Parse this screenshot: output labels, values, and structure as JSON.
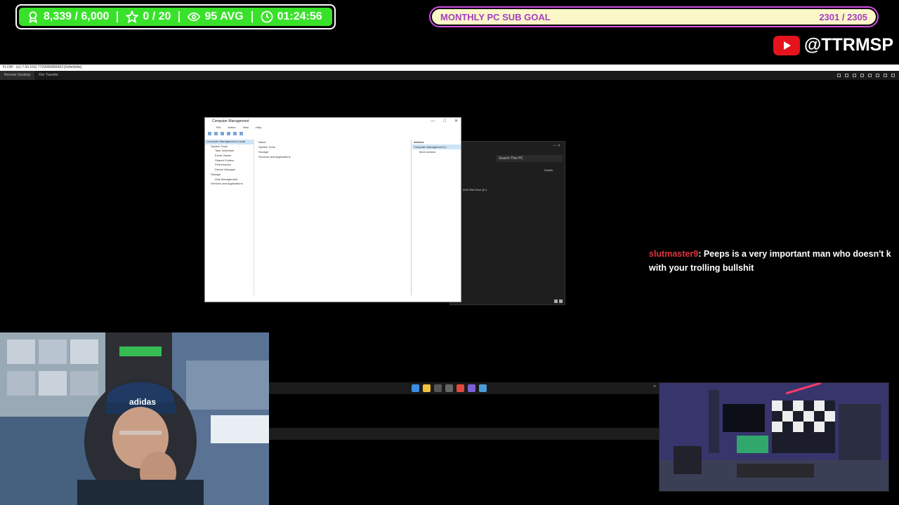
{
  "stats": {
    "followers": "8,339 / 6,000",
    "stars": "0 / 20",
    "viewers": "95 AVG",
    "timer": "01:24:56",
    "color": "#39e22a"
  },
  "goal": {
    "label": "MONTHLY PC SUB GOAL",
    "progress": "2301 / 2305",
    "border_color": "#d34fe6",
    "fill_color": "#fbf7c9"
  },
  "youtube": {
    "handle": "@TTRMSP",
    "icon": "youtube-play-icon"
  },
  "remote": {
    "title": "FLOW · (v1.7.50.153) 7729000866403 [0x8e0d4e]",
    "tabs": [
      "Remote Desktop",
      "File Transfer"
    ]
  },
  "explorer": {
    "search_placeholder": "Search This PC",
    "details_label": "Details",
    "drive_label": "DVD RW Drive (E:)"
  },
  "cm": {
    "title": "Computer Management",
    "menu": [
      "File",
      "Action",
      "View",
      "Help"
    ],
    "tree": [
      "Computer Management (Local)",
      "System Tools",
      "Task Scheduler",
      "Event Viewer",
      "Shared Folders",
      "Performance",
      "Device Manager",
      "Storage",
      "Disk Management",
      "Services and Applications"
    ],
    "middle_header": "Name",
    "middle_items": [
      "System Tools",
      "Storage",
      "Services and Applications"
    ],
    "actions_header": "Actions",
    "actions_sub": "Computer Management (L...",
    "actions_more": "More Actions"
  },
  "chat": {
    "user": "slutmaster9",
    "message": ": Peeps is a very important man who doesn't k",
    "message2": "with your trolling bullshit",
    "user_color": "#e0333b"
  },
  "webcam": {
    "hat_text": "adidas"
  }
}
